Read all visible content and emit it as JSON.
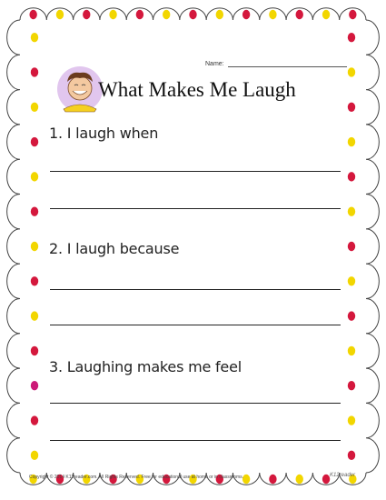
{
  "header": {
    "name_label": "Name:",
    "title": "What Makes Me Laugh",
    "illustration_icon": "laughing-child-icon"
  },
  "questions": [
    {
      "label": "1. I laugh when"
    },
    {
      "label": "2. I laugh because"
    },
    {
      "label": "3. Laughing makes me feel"
    }
  ],
  "footer": {
    "copyright": "Copyright © 2014 K12reader.com. All Rights Reserved. Free for educational use at home or in classrooms.",
    "brand": "K12reader"
  },
  "colors": {
    "frame_stroke": "#444444",
    "dot_red": "#d4183d",
    "dot_yellow": "#f2d600",
    "dot_magenta": "#cc1a78",
    "avatar_bg": "#e1c6ee"
  }
}
